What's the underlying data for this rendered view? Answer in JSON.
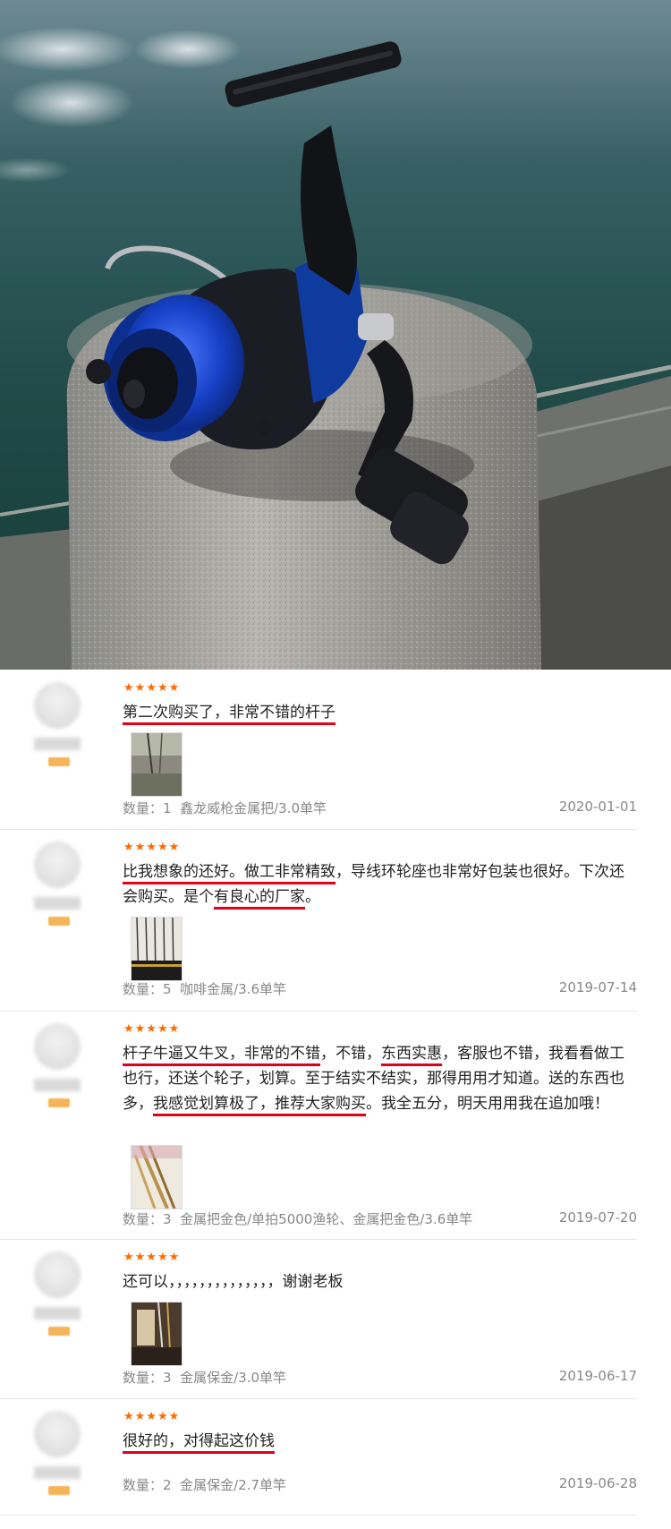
{
  "reviews": [
    {
      "stars": "★★★★★",
      "segments": [
        {
          "text": "第二次购买了，非常不错的杆子",
          "u": true
        }
      ],
      "qty_label": "数量：",
      "qty": "1",
      "sku": "鑫龙威枪金属把/3.0单竿",
      "date": "2020-01-01"
    },
    {
      "stars": "★★★★★",
      "segments": [
        {
          "text": "比我想象的还好。做工非常精致",
          "u": true
        },
        {
          "text": "，导线环轮座也非常好包装也很好。下次还会购买。是个",
          "u": false
        },
        {
          "text": "有良心的厂家",
          "u": true
        },
        {
          "text": "。",
          "u": false
        }
      ],
      "qty_label": "数量：",
      "qty": "5",
      "sku": "咖啡金属/3.6单竿",
      "date": "2019-07-14"
    },
    {
      "stars": "★★★★★",
      "segments": [
        {
          "text": "杆子牛逼又牛叉，非常的不错",
          "u": true
        },
        {
          "text": "，不错，",
          "u": false
        },
        {
          "text": "东西实惠",
          "u": true
        },
        {
          "text": "，客服也不错，我看看做工也行，还送个轮子，划算。至于结实不结实，那得用用才知道。送的东西也多，",
          "u": false
        },
        {
          "text": "我感觉划算极了，推荐大家购买",
          "u": true
        },
        {
          "text": "。我全五分，明天用用我在追加哦！",
          "u": false
        }
      ],
      "qty_label": "数量：",
      "qty": "3",
      "sku": "金属把金色/单拍5000渔轮、金属把金色/3.6单竿",
      "date": "2019-07-20"
    },
    {
      "stars": "★★★★★",
      "segments": [
        {
          "text": "还可以，，，，，，，，，，，，，，谢谢老板",
          "u": false
        }
      ],
      "qty_label": "数量：",
      "qty": "3",
      "sku": "金属保金/3.0单竿",
      "date": "2019-06-17"
    },
    {
      "stars": "★★★★★",
      "segments": [
        {
          "text": "很好的，对得起这价钱",
          "u": true
        }
      ],
      "qty_label": "数量：",
      "qty": "2",
      "sku": "金属保金/2.7单竿",
      "date": "2019-06-28"
    }
  ],
  "colors": {
    "star": "#ff6a00",
    "underline": "#e2001a",
    "meta_text": "#888888",
    "reel_blue": "#1742c8"
  },
  "icons": {
    "star": "star-icon",
    "avatar": "avatar-placeholder"
  }
}
